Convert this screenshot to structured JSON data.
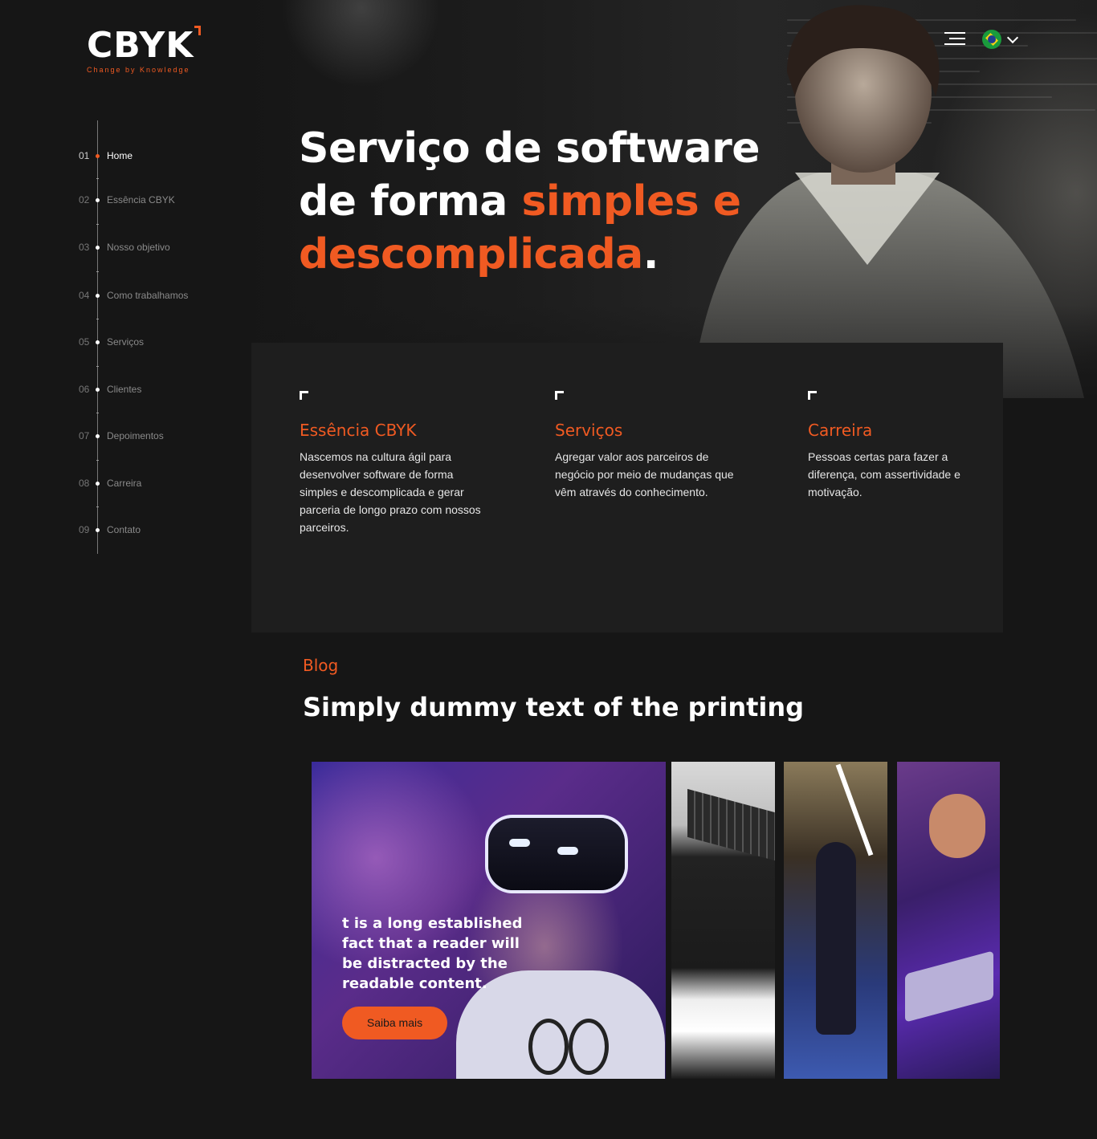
{
  "brand": {
    "logo_text": "CBYK",
    "tagline": "Change by Knowledge",
    "accent_color": "#f05a22"
  },
  "header": {
    "menu_icon": "hamburger-icon",
    "language_flag": "brazil-flag-icon",
    "language_chevron": "chevron-down-icon"
  },
  "sidenav": {
    "items": [
      {
        "num": "01",
        "label": "Home",
        "active": true
      },
      {
        "num": "02",
        "label": "Essência CBYK"
      },
      {
        "num": "03",
        "label": "Nosso objetivo"
      },
      {
        "num": "04",
        "label": "Como trabalhamos"
      },
      {
        "num": "05",
        "label": "Serviços"
      },
      {
        "num": "06",
        "label": "Clientes"
      },
      {
        "num": "07",
        "label": "Depoimentos"
      },
      {
        "num": "08",
        "label": "Carreira"
      },
      {
        "num": "09",
        "label": "Contato"
      }
    ]
  },
  "hero": {
    "line1": "Serviço de software",
    "line2_plain": "de forma ",
    "line2_accent": "simples e",
    "line3_accent": "descomplicada",
    "line3_end": "."
  },
  "cards": [
    {
      "title": "Essência CBYK",
      "text": "Nascemos na cultura ágil para desenvolver software de forma simples e descomplicada e gerar parceria de longo prazo com nossos parceiros."
    },
    {
      "title": "Serviços",
      "text": "Agregar valor aos parceiros de negócio por meio de mudanças que vêm através do conhecimento."
    },
    {
      "title": "Carreira",
      "text": "Pessoas certas para fazer a diferença, com assertividade e motivação."
    }
  ],
  "blog": {
    "label": "Blog",
    "title": "Simply dummy text of the printing",
    "featured_text": "t is a long established fact that a reader will be distracted by the readable content.",
    "cta_label": "Saiba mais"
  }
}
